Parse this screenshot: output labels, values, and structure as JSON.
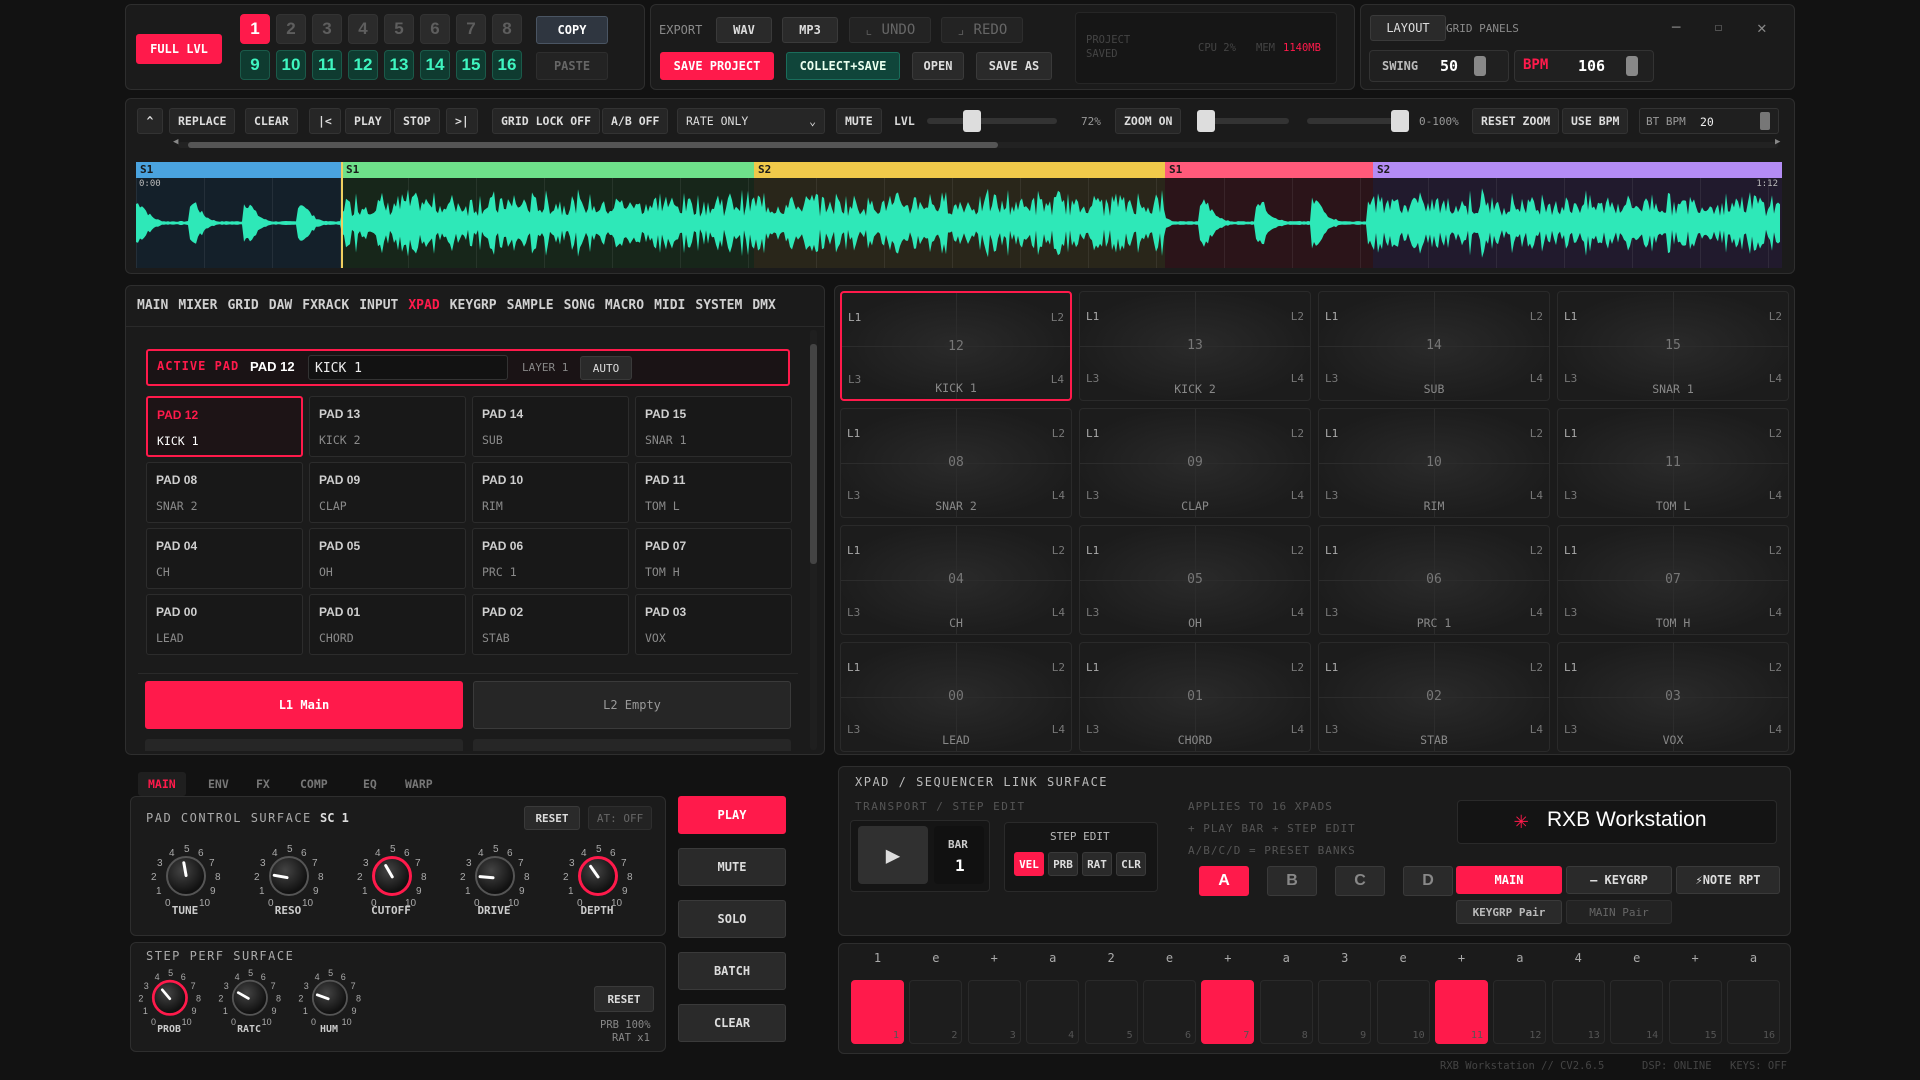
{
  "bank": {
    "full_lvl": "FULL LVL",
    "nums": [
      "1",
      "2",
      "3",
      "4",
      "5",
      "6",
      "7",
      "8"
    ],
    "nums2": [
      "9",
      "10",
      "11",
      "12",
      "13",
      "14",
      "15",
      "16"
    ],
    "copy": "COPY",
    "paste": "PASTE"
  },
  "file": {
    "export": "EXPORT",
    "wav": "WAV",
    "mp3": "MP3",
    "undo": "⌞ UNDO",
    "redo": "⌟ REDO",
    "save_project": "SAVE PROJECT",
    "collect_save": "COLLECT+SAVE",
    "open": "OPEN",
    "save_as": "SAVE AS"
  },
  "status": {
    "line1": "PROJECT",
    "line2": "SAVED",
    "cpu": "CPU 2%",
    "mem_label": "MEM",
    "mem_value": "1140MB"
  },
  "layout": {
    "layout": "LAYOUT",
    "grid_panels": "GRID PANELS",
    "swing_label": "SWING",
    "swing_value": "50",
    "bpm_label": "BPM",
    "bpm_value": "106"
  },
  "transport": {
    "up": "^",
    "replace": "REPLACE",
    "clear": "CLEAR",
    "start": "|<",
    "play": "PLAY",
    "stop": "STOP",
    "end": ">|",
    "grid_lock": "GRID LOCK OFF",
    "ab": "A/B OFF",
    "rate": "RATE ONLY",
    "mute": "MUTE",
    "lvl": "LVL",
    "pct": "72%",
    "zoom_on": "ZOOM ON",
    "range": "0-100%",
    "reset_zoom": "RESET ZOOM",
    "use_bpm": "USE BPM",
    "bt_bpm": "BT BPM",
    "bt_value": "20"
  },
  "wave": {
    "start_time": "0:00",
    "end_time": "1:12",
    "segments": [
      {
        "label": "S1",
        "color": "#4aa3df",
        "fill": "#14202a"
      },
      {
        "label": "S1",
        "color": "#6ee08a",
        "fill": "#17261a"
      },
      {
        "label": "S2",
        "color": "#f0c94a",
        "fill": "#29261a"
      },
      {
        "label": "S1",
        "color": "#ff5a7a",
        "fill": "#2b1419"
      },
      {
        "label": "S2",
        "color": "#b48cf5",
        "fill": "#211a2d"
      }
    ]
  },
  "tabs": [
    "MAIN",
    "MIXER",
    "GRID",
    "DAW",
    "FXRACK",
    "INPUT",
    "XPAD",
    "KEYGRP",
    "SAMPLE",
    "SONG",
    "MACRO",
    "MIDI",
    "SYSTEM",
    "DMX"
  ],
  "active_tab": "XPAD",
  "active_pad": {
    "label": "ACTIVE PAD",
    "pad": "PAD 12",
    "name": "KICK 1",
    "layer": "LAYER 1",
    "auto": "AUTO"
  },
  "pads": [
    {
      "id": "PAD 12",
      "name": "KICK 1"
    },
    {
      "id": "PAD 13",
      "name": "KICK 2"
    },
    {
      "id": "PAD 14",
      "name": "SUB"
    },
    {
      "id": "PAD 15",
      "name": "SNAR 1"
    },
    {
      "id": "PAD 08",
      "name": "SNAR 2"
    },
    {
      "id": "PAD 09",
      "name": "CLAP"
    },
    {
      "id": "PAD 10",
      "name": "RIM"
    },
    {
      "id": "PAD 11",
      "name": "TOM L"
    },
    {
      "id": "PAD 04",
      "name": "CH"
    },
    {
      "id": "PAD 05",
      "name": "OH"
    },
    {
      "id": "PAD 06",
      "name": "PRC 1"
    },
    {
      "id": "PAD 07",
      "name": "TOM H"
    },
    {
      "id": "PAD 00",
      "name": "LEAD"
    },
    {
      "id": "PAD 01",
      "name": "CHORD"
    },
    {
      "id": "PAD 02",
      "name": "STAB"
    },
    {
      "id": "PAD 03",
      "name": "VOX"
    }
  ],
  "layers": {
    "l1": "L1  Main",
    "l2": "L2  Empty"
  },
  "xpads": [
    {
      "n": "12",
      "name": "KICK 1"
    },
    {
      "n": "13",
      "name": "KICK 2"
    },
    {
      "n": "14",
      "name": "SUB"
    },
    {
      "n": "15",
      "name": "SNAR 1"
    },
    {
      "n": "08",
      "name": "SNAR 2"
    },
    {
      "n": "09",
      "name": "CLAP"
    },
    {
      "n": "10",
      "name": "RIM"
    },
    {
      "n": "11",
      "name": "TOM L"
    },
    {
      "n": "04",
      "name": "CH"
    },
    {
      "n": "05",
      "name": "OH"
    },
    {
      "n": "06",
      "name": "PRC 1"
    },
    {
      "n": "07",
      "name": "TOM H"
    },
    {
      "n": "00",
      "name": "LEAD"
    },
    {
      "n": "01",
      "name": "CHORD"
    },
    {
      "n": "02",
      "name": "STAB"
    },
    {
      "n": "03",
      "name": "VOX"
    }
  ],
  "corners": {
    "l1": "L1",
    "l2": "L2",
    "l3": "L3",
    "l4": "L4"
  },
  "subtabs": [
    "MAIN",
    "ENV",
    "FX",
    "COMP",
    "EQ",
    "WARP"
  ],
  "pad_ctrl": {
    "title": "PAD CONTROL SURFACE",
    "sc": "SC 1",
    "reset": "RESET",
    "at": "AT: OFF",
    "knobs": [
      {
        "label": "TUNE",
        "deg": -10
      },
      {
        "label": "RESO",
        "deg": -80
      },
      {
        "label": "CUTOFF",
        "deg": -30
      },
      {
        "label": "DRIVE",
        "deg": -85
      },
      {
        "label": "DEPTH",
        "deg": -35
      }
    ]
  },
  "step_perf": {
    "title": "STEP PERF SURFACE",
    "reset": "RESET",
    "prb": "PRB 100%",
    "rat": "RAT x1",
    "knobs": [
      {
        "label": "PROB",
        "deg": -40
      },
      {
        "label": "RATC",
        "deg": -60
      },
      {
        "label": "HUM",
        "deg": -70
      }
    ]
  },
  "side_buttons": [
    "PLAY",
    "MUTE",
    "SOLO",
    "BATCH",
    "CLEAR"
  ],
  "seq": {
    "title": "XPAD / SEQUENCER LINK SURFACE",
    "sub": "TRANSPORT / STEP EDIT",
    "bar_label": "BAR",
    "bar_value": "1",
    "step_edit": "STEP EDIT",
    "modes": [
      "VEL",
      "PRB",
      "RAT",
      "CLR"
    ],
    "info": [
      "APPLIES TO 16 XPADS",
      "+ PLAY BAR + STEP EDIT",
      "A/B/C/D = PRESET BANKS"
    ],
    "banks": [
      "A",
      "B",
      "C",
      "D"
    ],
    "brand": "RXB Workstation",
    "main": "MAIN",
    "keygrp": "— KEYGRP",
    "note_rpt": "⚡NOTE RPT",
    "keygrp_pair": "KEYGRP Pair",
    "main_pair": "MAIN Pair"
  },
  "step_labels": [
    "1",
    "e",
    "+",
    "a",
    "2",
    "e",
    "+",
    "a",
    "3",
    "e",
    "+",
    "a",
    "4",
    "e",
    "+",
    "a"
  ],
  "steps_on": [
    1,
    0,
    0,
    0,
    0,
    0,
    1,
    0,
    0,
    0,
    1,
    0,
    0,
    0,
    0,
    0
  ],
  "footer": {
    "app": "RXB Workstation // CV2.6.5",
    "dsp": "DSP: ONLINE",
    "keys": "KEYS: OFF"
  }
}
